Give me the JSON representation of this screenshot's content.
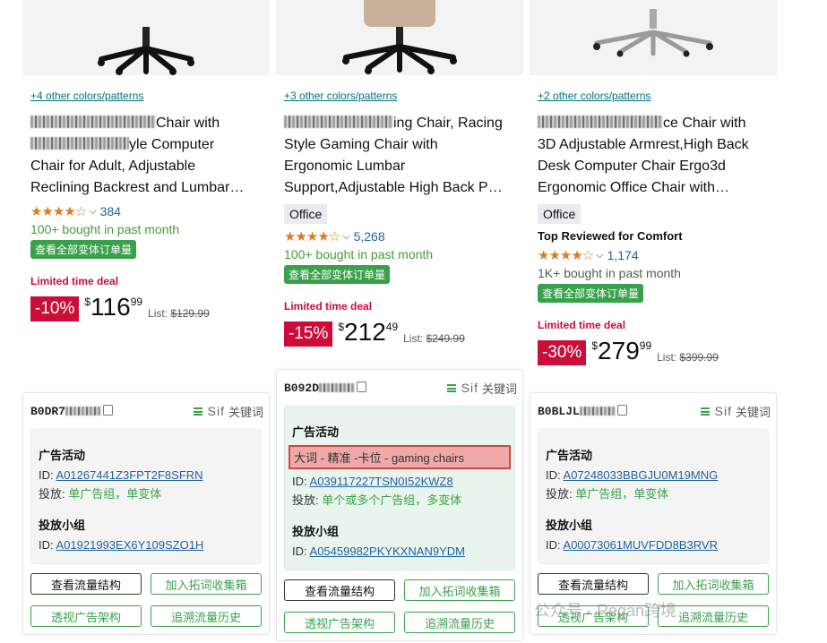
{
  "products": [
    {
      "colors_link": "+4 other colors/patterns",
      "title_lines": [
        "Chair with",
        "yle Computer",
        "Chair for Adult, Adjustable",
        "Reclining Backrest and Lumbar…"
      ],
      "badge": "",
      "top_label": "",
      "stars": "★★★★☆",
      "rating_count": "384",
      "bought": "100+ bought in past month",
      "variant_button": "查看全部变体订单量",
      "deal": "Limited time deal",
      "discount": "-10%",
      "currency": "$",
      "price_whole": "116",
      "price_fraction": "99",
      "list_label": "List:",
      "list_price": "$129.99"
    },
    {
      "colors_link": "+3 other colors/patterns",
      "title_lines": [
        "ing Chair, Racing",
        "Style Gaming Chair with",
        "Ergonomic Lumbar",
        "Support,Adjustable High Back P…"
      ],
      "badge": "Office",
      "top_label": "",
      "stars": "★★★★☆",
      "rating_count": "5,268",
      "bought": "100+ bought in past month",
      "variant_button": "查看全部变体订单量",
      "deal": "Limited time deal",
      "discount": "-15%",
      "currency": "$",
      "price_whole": "212",
      "price_fraction": "49",
      "list_label": "List:",
      "list_price": "$249.99"
    },
    {
      "colors_link": "+2 other colors/patterns",
      "title_lines": [
        "ce Chair with",
        "3D Adjustable Armrest,High Back",
        "Desk Computer Chair Ergo3d",
        "Ergonomic Office Chair with…"
      ],
      "badge": "Office",
      "top_label": "Top Reviewed for Comfort",
      "stars": "★★★★☆",
      "rating_count": "1,174",
      "bought": "1K+ bought in past month",
      "variant_button": "查看全部变体订单量",
      "deal": "Limited time deal",
      "discount": "-30%",
      "currency": "$",
      "price_whole": "279",
      "price_fraction": "99",
      "list_label": "List:",
      "list_price": "$399.99"
    }
  ],
  "panels": [
    {
      "asin": "B0DR7",
      "sif_label": "Sif",
      "sif_keyword": "关键词",
      "campaign_title": "广告活动",
      "campaign_id_label": "ID:",
      "campaign_id": "A01267441Z3FPT2F8SFRN",
      "delivery_label": "投放:",
      "delivery_value": "单广告组，单变体",
      "group_title": "投放小组",
      "group_id_label": "ID:",
      "group_id": "A01921993EX6Y109SZO1H",
      "btn_traffic": "查看流量结构",
      "btn_keyword": "加入拓词收集箱",
      "btn_ad_arch": "透视广告架构",
      "btn_history": "追溯流量历史"
    },
    {
      "asin": "B092D",
      "sif_label": "Sif",
      "sif_keyword": "关键词",
      "campaign_title": "广告活动",
      "campaign_highlight": "大词 - 精准 -卡位 - gaming chairs",
      "campaign_id_label": "ID:",
      "campaign_id": "A039117227TSN0I52KWZ8",
      "delivery_label": "投放:",
      "delivery_value": "单个或多个广告组，多变体",
      "group_title": "投放小组",
      "group_id_label": "ID:",
      "group_id": "A05459982PKYKXNAN9YDM",
      "btn_traffic": "查看流量结构",
      "btn_keyword": "加入拓词收集箱",
      "btn_ad_arch": "透视广告架构",
      "btn_history": "追溯流量历史"
    },
    {
      "asin": "B0BLJL",
      "sif_label": "Sif",
      "sif_keyword": "关键词",
      "campaign_title": "广告活动",
      "campaign_id_label": "ID:",
      "campaign_id": "A07248033BBGJU0M19MNG",
      "delivery_label": "投放:",
      "delivery_value": "单广告组，单变体",
      "group_title": "投放小组",
      "group_id_label": "ID:",
      "group_id": "A00073061MUVFDD8B3RVR",
      "btn_traffic": "查看流量结构",
      "btn_keyword": "加入拓词收集箱",
      "btn_ad_arch": "透视广告架构",
      "btn_history": "追溯流量历史"
    }
  ],
  "watermark": "公众号 · Regan跨境",
  "colors": {
    "accent_green": "#3aa14b",
    "deal_red": "#cc0c39",
    "link_blue": "#2162a1",
    "star_orange": "#de7921"
  }
}
